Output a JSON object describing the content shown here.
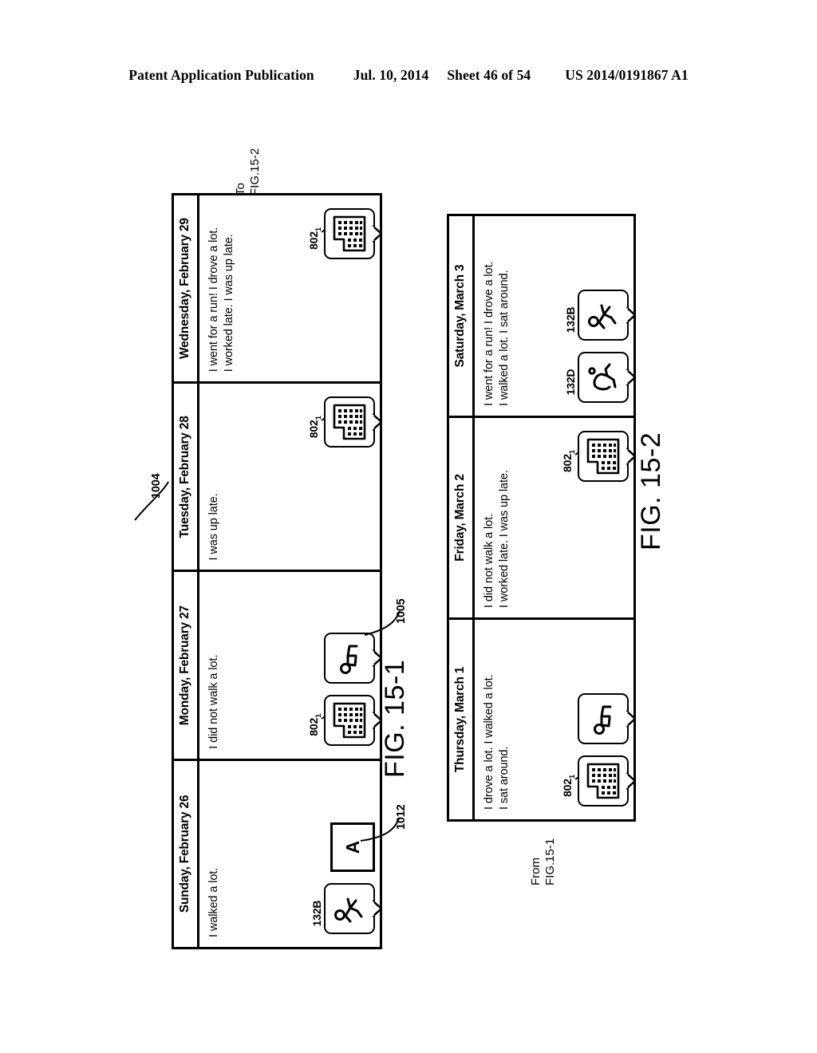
{
  "header": {
    "publication": "Patent Application Publication",
    "date": "Jul. 10, 2014",
    "sheet": "Sheet 46 of 54",
    "patent_number": "US 2014/0191867 A1"
  },
  "figures": [
    {
      "id": "fig1",
      "caption": "FIG. 15-1",
      "connector_note": "To\nFIG.15-2",
      "strip_ref": "1004",
      "days": [
        {
          "title": "Sunday, February 26",
          "text": "I walked a lot.",
          "cards": [
            {
              "icon": "walking-person-icon",
              "ref": "132B",
              "ref_sub": ""
            },
            {
              "icon": "letter-a-box",
              "ref": "",
              "ref_sub": ""
            }
          ]
        },
        {
          "title": "Monday, February 27",
          "text": "I did not walk a lot.",
          "cards": [
            {
              "icon": "office-building-icon",
              "ref": "802",
              "ref_sub": "1"
            },
            {
              "icon": "sitting-person-icon",
              "ref": "",
              "ref_sub": ""
            }
          ]
        },
        {
          "title": "Tuesday, February 28",
          "text": "I was up late.",
          "cards": [
            {
              "icon": "office-building-icon",
              "ref": "802",
              "ref_sub": "1"
            }
          ]
        },
        {
          "title": "Wednesday, February 29",
          "text": "I went for a run! I drove a lot.\nI worked late. I was up late.",
          "cards": [
            {
              "icon": "office-building-icon",
              "ref": "802",
              "ref_sub": "1"
            }
          ]
        }
      ]
    },
    {
      "id": "fig2",
      "caption": "FIG. 15-2",
      "connector_note": "From\nFIG.15-1",
      "days": [
        {
          "title": "Thursday, March 1",
          "text": "I drove a lot. I walked a lot.\nI sat around.",
          "cards": [
            {
              "icon": "office-building-icon",
              "ref": "802",
              "ref_sub": "1"
            },
            {
              "icon": "sitting-person-icon",
              "ref": "",
              "ref_sub": ""
            }
          ]
        },
        {
          "title": "Friday, March 2",
          "text": "I did not walk a lot.\nI worked late. I was up late.",
          "cards": [
            {
              "icon": "office-building-icon",
              "ref": "802",
              "ref_sub": "1"
            }
          ]
        },
        {
          "title": "Saturday, March 3",
          "text": "I went for a run! I drove a lot.\nI walked a lot. I sat around.",
          "cards": [
            {
              "icon": "running-person-icon",
              "ref": "132D",
              "ref_sub": ""
            },
            {
              "icon": "walking-person-icon",
              "ref": "132B",
              "ref_sub": ""
            }
          ]
        }
      ]
    }
  ],
  "callouts": [
    {
      "id": "1004",
      "label": "1004"
    },
    {
      "id": "1005",
      "label": "1005"
    },
    {
      "id": "1012",
      "label": "1012"
    }
  ],
  "letter_box_text": "A"
}
